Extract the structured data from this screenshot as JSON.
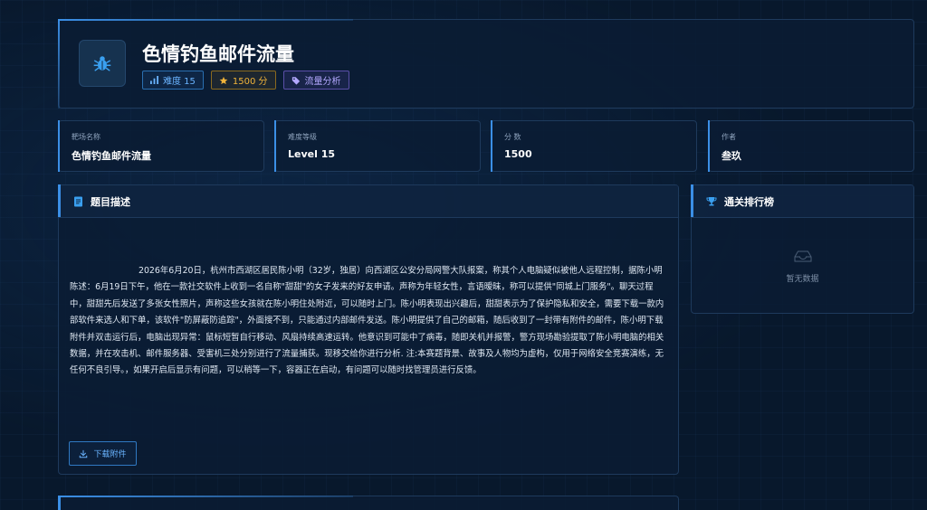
{
  "challenge": {
    "title": "色情钓鱼邮件流量",
    "icon": "bug-icon",
    "tags": {
      "difficulty": "难度 15",
      "score": "1500 分",
      "category": "流量分析"
    }
  },
  "info_cards": [
    {
      "label": "靶场名称",
      "value": "色情钓鱼邮件流量"
    },
    {
      "label": "难度等级",
      "value": "Level 15"
    },
    {
      "label": "分 数",
      "value": "1500"
    },
    {
      "label": "作者",
      "value": "叁玖"
    }
  ],
  "description": {
    "header": "题目描述",
    "text": "2026年6月20日，杭州市西湖区居民陈小明（32岁，独居）向西湖区公安分局网警大队报案，称其个人电脑疑似被他人远程控制，据陈小明陈述：6月19日下午，他在一款社交软件上收到一名自称\"甜甜\"的女子发来的好友申请。声称为年轻女性，言语暧昧，称可以提供\"同城上门服务\"。聊天过程中，甜甜先后发送了多张女性照片，声称这些女孩就在陈小明住处附近，可以随时上门。陈小明表现出兴趣后，甜甜表示为了保护隐私和安全，需要下载一款内部软件来选人和下单，该软件\"防屏蔽防追踪\"，外面搜不到，只能通过内部邮件发送。陈小明提供了自己的邮箱，随后收到了一封带有附件的邮件，陈小明下载附件并双击运行后，电脑出现异常：鼠标短暂自行移动、风扇持续高速运转。他意识到可能中了病毒，随即关机并报警，警方现场勘验提取了陈小明电脑的相关数据，并在攻击机、邮件服务器、受害机三处分别进行了流量捕获。现移交给你进行分析. 注:本赛题背景、故事及人物均为虚构，仅用于网络安全竞赛演练，无任何不良引导。，如果开启后显示有问题，可以稍等一下，容器正在启动，有问题可以随时找管理员进行反馈。",
    "download_label": "下载附件"
  },
  "leaderboard": {
    "header": "通关排行榜",
    "empty_text": "暂无数据"
  },
  "colors": {
    "accent": "#3b8fe6",
    "gold": "#f0b33a",
    "purple": "#b3a8ff",
    "background": "#08182c"
  }
}
